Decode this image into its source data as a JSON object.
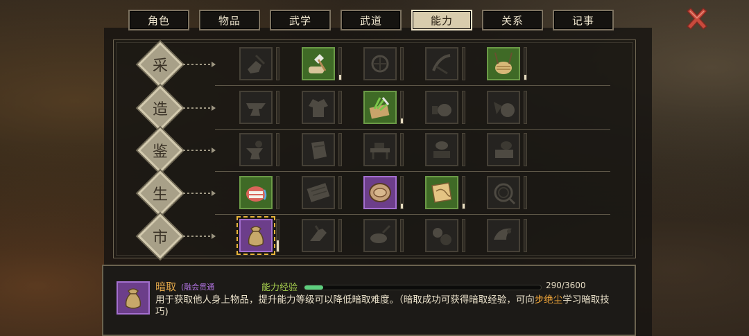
{
  "tabs": [
    {
      "label": "角色",
      "active": false
    },
    {
      "label": "物品",
      "active": false
    },
    {
      "label": "武学",
      "active": false
    },
    {
      "label": "武道",
      "active": false
    },
    {
      "label": "能力",
      "active": true
    },
    {
      "label": "关系",
      "active": false
    },
    {
      "label": "记事",
      "active": false
    }
  ],
  "categories": [
    {
      "label": "采",
      "skills": [
        {
          "icon": "pickaxe-ore-icon",
          "state": "locked",
          "level": 0
        },
        {
          "icon": "woodcutting-axe-icon",
          "state": "unlocked",
          "level": 0.15
        },
        {
          "icon": "fishing-net-icon",
          "state": "locked",
          "level": 0
        },
        {
          "icon": "sickle-icon",
          "state": "locked",
          "level": 0
        },
        {
          "icon": "herb-basket-icon",
          "state": "unlocked",
          "level": 0.15
        }
      ]
    },
    {
      "label": "造",
      "skills": [
        {
          "icon": "anvil-icon",
          "state": "locked",
          "level": 0
        },
        {
          "icon": "garment-icon",
          "state": "locked",
          "level": 0
        },
        {
          "icon": "herb-cutting-icon",
          "state": "unlocked",
          "level": 0.15
        },
        {
          "icon": "cooking-pot-icon",
          "state": "locked",
          "level": 0
        },
        {
          "icon": "crafting-tools-icon",
          "state": "locked",
          "level": 0
        }
      ]
    },
    {
      "label": "鉴",
      "skills": [
        {
          "icon": "appraise-anvil-icon",
          "state": "locked",
          "level": 0
        },
        {
          "icon": "appraise-cloth-icon",
          "state": "locked",
          "level": 0
        },
        {
          "icon": "appraise-table-icon",
          "state": "locked",
          "level": 0
        },
        {
          "icon": "appraise-jade-icon",
          "state": "locked",
          "level": 0
        },
        {
          "icon": "appraise-scroll-icon",
          "state": "locked",
          "level": 0
        }
      ]
    },
    {
      "label": "生",
      "skills": [
        {
          "icon": "mouth-eloquence-icon",
          "state": "unlocked",
          "level": 0
        },
        {
          "icon": "tablet-icon",
          "state": "locked",
          "level": 0
        },
        {
          "icon": "rouge-box-icon",
          "state": "rare",
          "level": 0.15
        },
        {
          "icon": "map-scroll-icon",
          "state": "unlocked",
          "level": 0.15
        },
        {
          "icon": "whip-coil-icon",
          "state": "locked",
          "level": 0
        }
      ]
    },
    {
      "label": "市",
      "skills": [
        {
          "icon": "money-pouch-icon",
          "state": "rare",
          "level": 0.35,
          "selected": true
        },
        {
          "icon": "hand-steal-icon",
          "state": "locked",
          "level": 0
        },
        {
          "icon": "bowl-ladle-icon",
          "state": "locked",
          "level": 0
        },
        {
          "icon": "gear-mechanism-icon",
          "state": "locked",
          "level": 0
        },
        {
          "icon": "horn-icon",
          "state": "locked",
          "level": 0
        }
      ]
    }
  ],
  "detail": {
    "icon": "money-pouch-icon",
    "name": "暗取",
    "grade": "(融会贯通",
    "xp_label": "能力经验",
    "xp_text": "290/3600",
    "xp_fraction": 0.0806,
    "desc_prefix": "用于获取他人身上物品，提升能力等级可以降低暗取难度。（暗取成功可获得暗取经验，可向",
    "desc_highlight": "步绝尘",
    "desc_suffix": "学习暗取技巧)"
  },
  "colors": {
    "unlocked": "#3f6a26",
    "rare": "#6c3e8a",
    "locked": "#252320",
    "accent": "#e3a84a",
    "xp": "#5dcf7e",
    "close": "#c94a3c"
  }
}
